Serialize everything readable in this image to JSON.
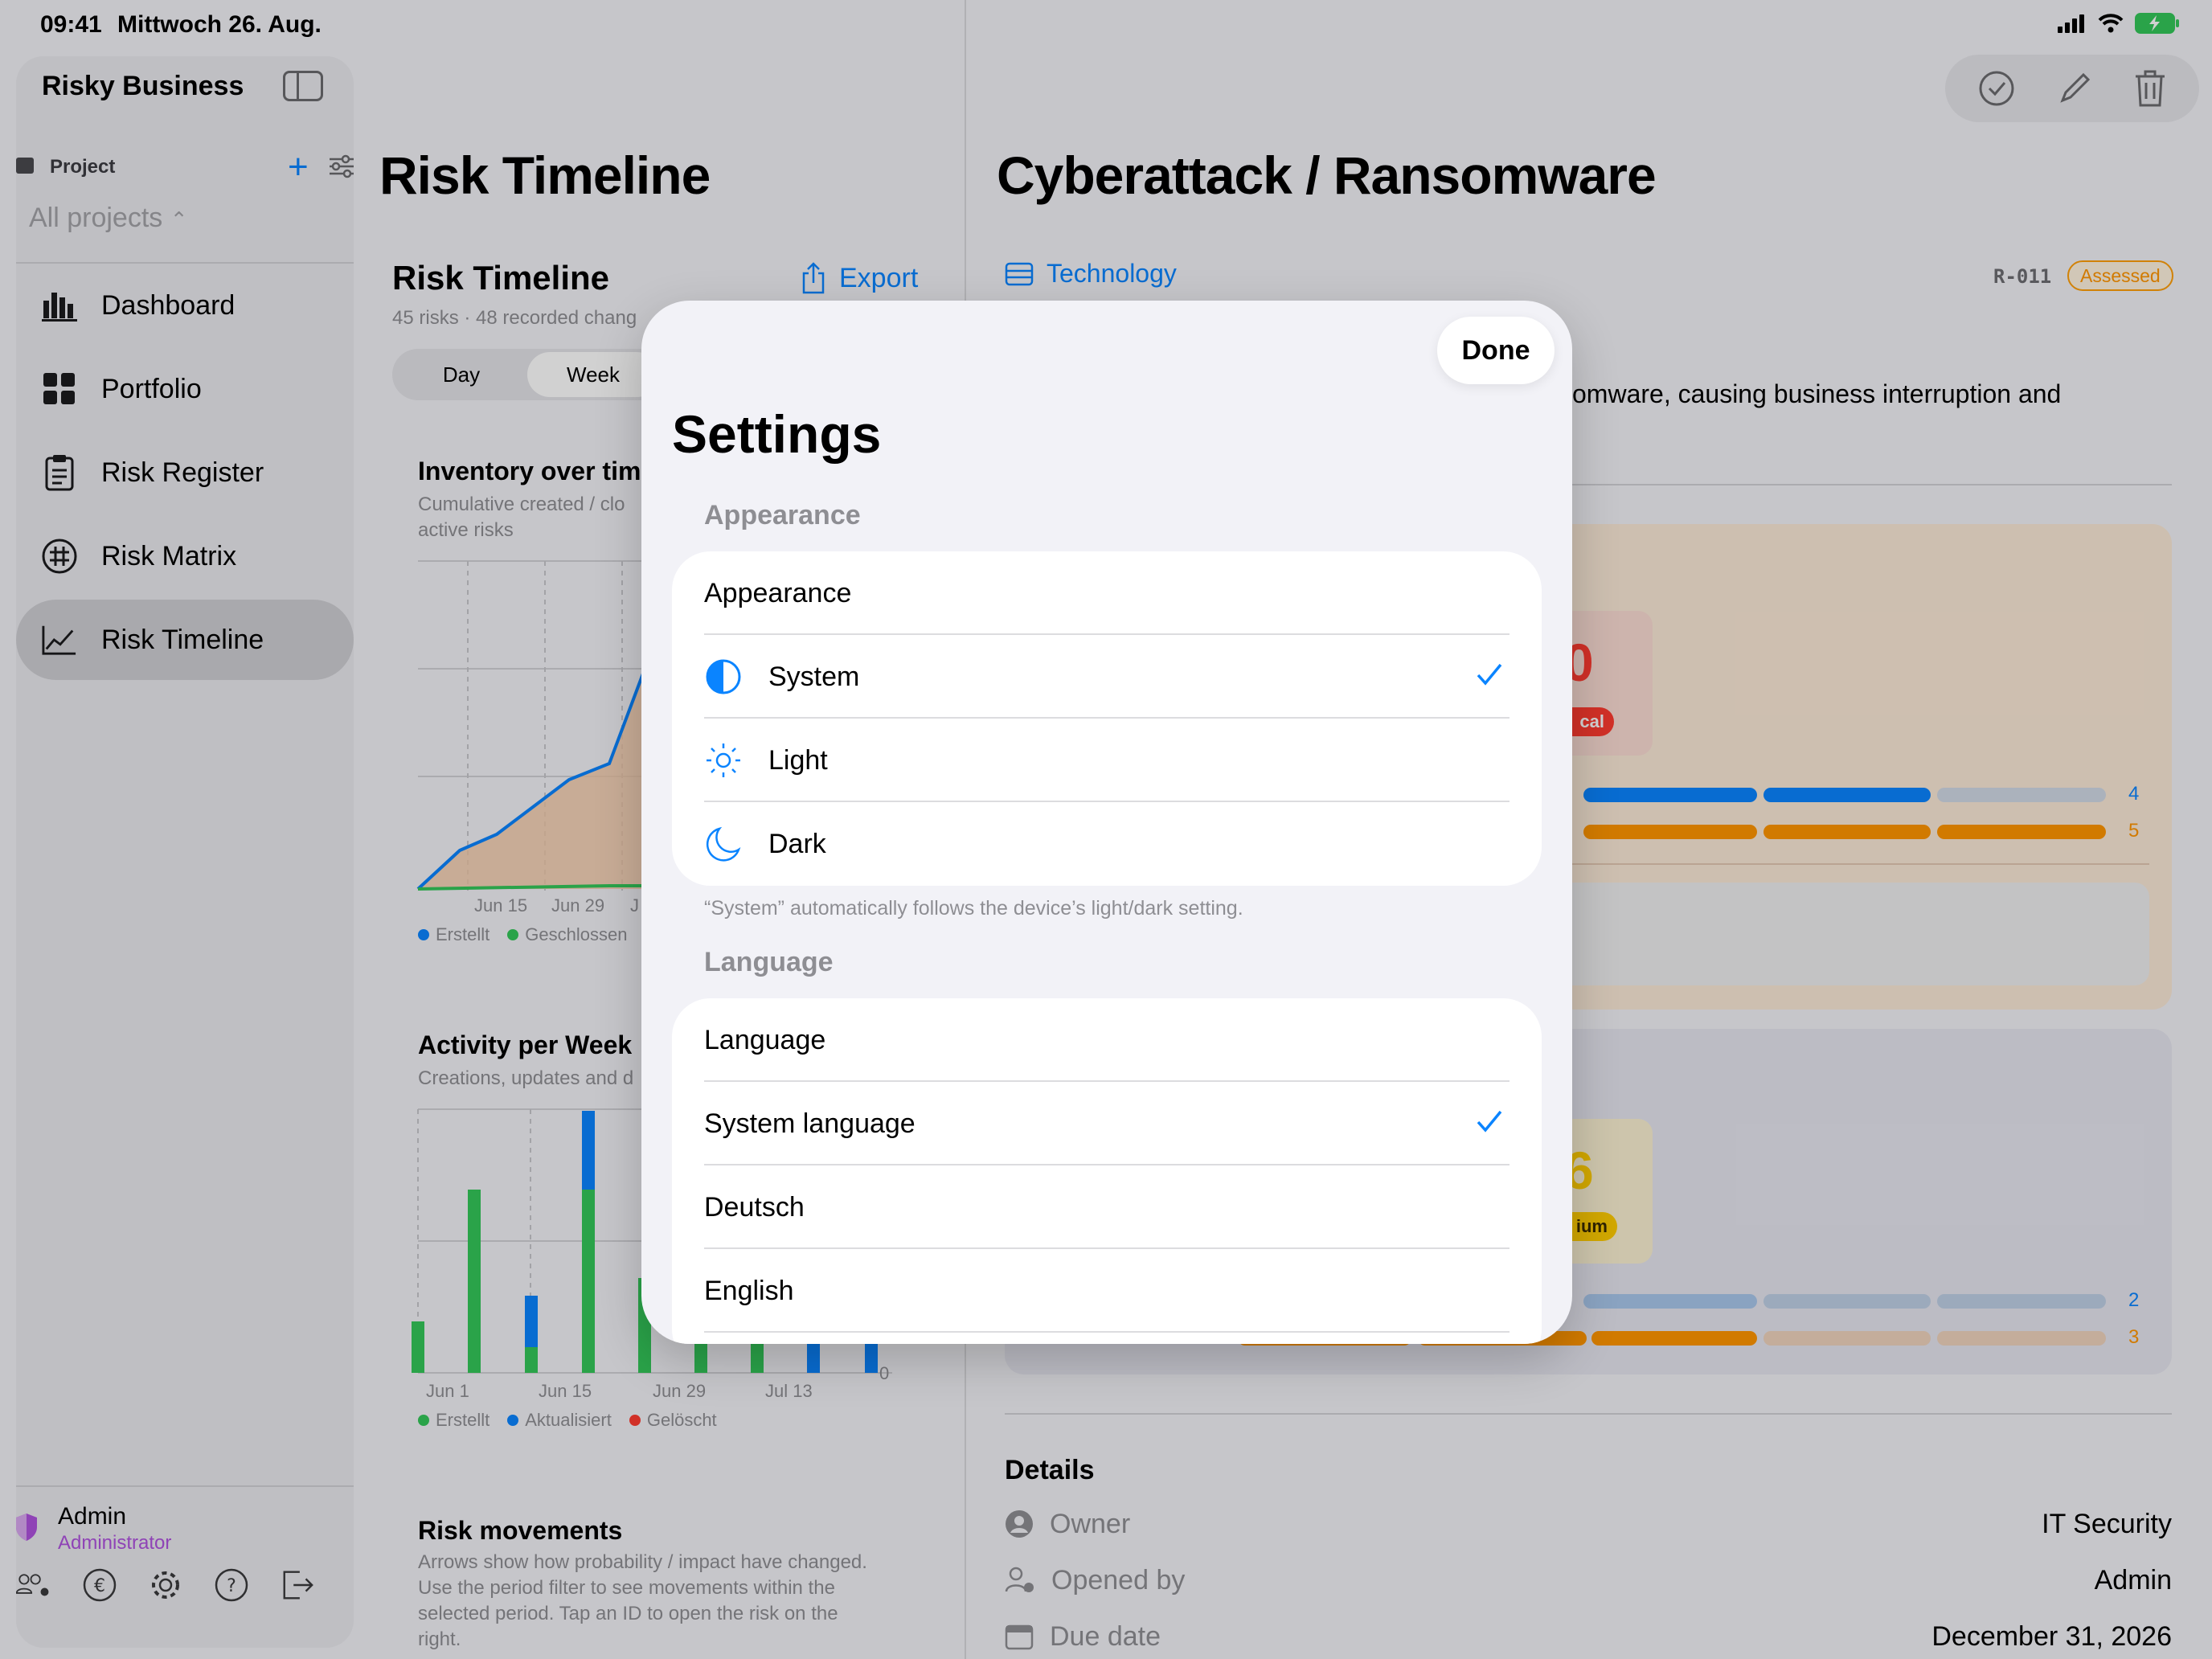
{
  "status_bar": {
    "time": "09:41",
    "date": "Mittwoch 26. Aug."
  },
  "sidebar": {
    "app_title": "Risky Business",
    "project_label": "Project",
    "project_select": "All projects",
    "items": [
      {
        "label": "Dashboard",
        "icon": "bar-chart-icon"
      },
      {
        "label": "Portfolio",
        "icon": "grid-icon"
      },
      {
        "label": "Risk Register",
        "icon": "clipboard-icon"
      },
      {
        "label": "Risk Matrix",
        "icon": "matrix-icon"
      },
      {
        "label": "Risk Timeline",
        "icon": "trend-icon"
      }
    ],
    "active_item": "Risk Timeline",
    "user": {
      "name": "Admin",
      "role": "Administrator"
    }
  },
  "middle": {
    "title": "Risk Timeline",
    "section_title": "Risk Timeline",
    "meta": "45 risks · 48 recorded chang",
    "export_label": "Export",
    "segments": [
      "Day",
      "Week"
    ],
    "active_segment": "Week",
    "inventory": {
      "title": "Inventory over tim",
      "subtitle_line1": "Cumulative created / clo",
      "subtitle_line2": "active risks",
      "x_ticks": [
        "Jun 15",
        "Jun 29",
        "J"
      ],
      "legend": [
        "Erstellt",
        "Geschlossen"
      ]
    },
    "activity": {
      "title": "Activity per Week",
      "subtitle": "Creations, updates and d",
      "x_ticks": [
        "Jun 1",
        "Jun 15",
        "Jun 29",
        "Jul 13"
      ],
      "zero_tick": "0",
      "legend": [
        "Erstellt",
        "Aktualisiert",
        "Gelöscht"
      ]
    },
    "movements": {
      "title": "Risk movements",
      "text_lines": [
        "Arrows show how probability / impact have changed.",
        "Use the period filter to see movements within the",
        "selected period. Tap an ID to open the risk on the",
        "right."
      ]
    }
  },
  "right": {
    "title": "Cyberattack / Ransomware",
    "category": "Technology",
    "risk_id": "R-011",
    "status": "Assessed",
    "description_fragment": "somware, causing business interruption and",
    "score_critical": "0",
    "critical_label": "cal",
    "score_medium": "6",
    "medium_label": "ium",
    "bar_values": [
      "4",
      "5",
      "2",
      "3"
    ],
    "details_title": "Details",
    "details": [
      {
        "label": "Owner",
        "value": "IT Security",
        "icon": "person-circle-icon"
      },
      {
        "label": "Opened by",
        "value": "Admin",
        "icon": "person-add-icon"
      },
      {
        "label": "Due date",
        "value": "December 31, 2026",
        "icon": "calendar-icon"
      }
    ]
  },
  "settings": {
    "title": "Settings",
    "done_label": "Done",
    "appearance_header": "Appearance",
    "appearance_row_title": "Appearance",
    "appearance_options": [
      {
        "label": "System",
        "icon": "half-circle-icon",
        "selected": true
      },
      {
        "label": "Light",
        "icon": "sun-icon",
        "selected": false
      },
      {
        "label": "Dark",
        "icon": "moon-icon",
        "selected": false
      }
    ],
    "appearance_footnote": "“System” automatically follows the device’s light/dark setting.",
    "language_header": "Language",
    "language_row_title": "Language",
    "language_options": [
      {
        "label": "System language",
        "selected": true
      },
      {
        "label": "Deutsch",
        "selected": false
      },
      {
        "label": "English",
        "selected": false
      }
    ]
  },
  "colors": {
    "accent": "#0a84ff",
    "green": "#34c759",
    "orange": "#ff9500",
    "critical": "#ff3b30",
    "medium": "#ffcc00",
    "purple": "#af52de"
  }
}
